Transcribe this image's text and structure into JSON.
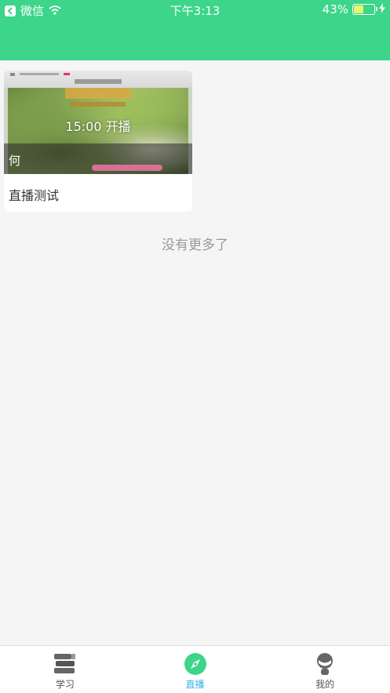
{
  "status_bar": {
    "app_name": "微信",
    "time": "下午3:13",
    "battery": "43%",
    "battery_level": 0.43
  },
  "live_list": [
    {
      "time_label": "15:00 开播",
      "anchor": "何",
      "title": "直播测试"
    }
  ],
  "footer_text": "没有更多了",
  "tabs": [
    {
      "label": "学习",
      "icon": "books-icon",
      "active": false
    },
    {
      "label": "直播",
      "icon": "compass-icon",
      "active": true
    },
    {
      "label": "我的",
      "icon": "user-icon",
      "active": false
    }
  ],
  "colors": {
    "header": "#3cd58a",
    "tab_active": "#33b3e6",
    "tab_inactive": "#555555"
  }
}
